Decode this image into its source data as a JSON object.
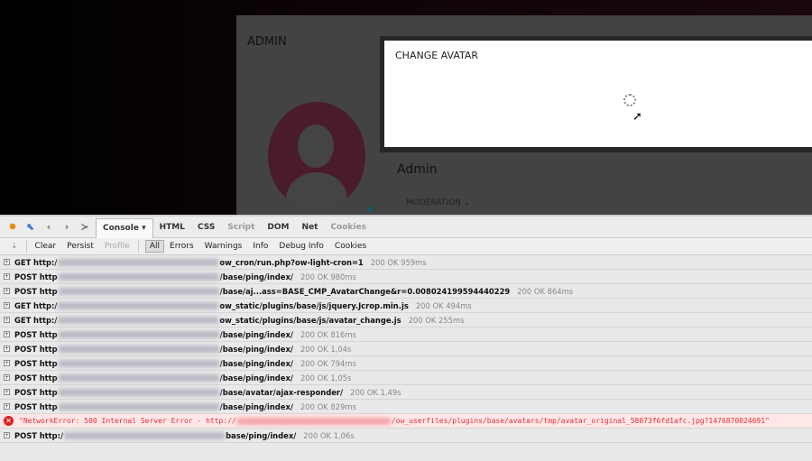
{
  "page": {
    "header": "ADMIN",
    "profile_name": "Admin",
    "moderation_label": "MODERATION",
    "moderation_icon": "chevron-down-icon"
  },
  "modal": {
    "title": "CHANGE AVATAR"
  },
  "devtools": {
    "tabs": [
      "Console",
      "HTML",
      "CSS",
      "Script",
      "DOM",
      "Net",
      "Cookies"
    ],
    "console_toolbar": [
      "Clear",
      "Persist",
      "Profile",
      "All",
      "Errors",
      "Warnings",
      "Info",
      "Debug Info",
      "Cookies"
    ],
    "rows": [
      {
        "method": "GET",
        "prefix": "http:/",
        "path": "ow_cron/run.php?ow-light-cron=1",
        "status": "200 OK 959ms"
      },
      {
        "method": "POST",
        "prefix": "http",
        "path": "/base/ping/index/",
        "status": "200 OK 980ms"
      },
      {
        "method": "POST",
        "prefix": "http",
        "path": "/base/aj...ass=BASE_CMP_AvatarChange&r=0.008024199594440229",
        "status": "200 OK 864ms"
      },
      {
        "method": "GET",
        "prefix": "http:/",
        "path": "ow_static/plugins/base/js/jquery.Jcrop.min.js",
        "status": "200 OK 494ms"
      },
      {
        "method": "GET",
        "prefix": "http:/",
        "path": "ow_static/plugins/base/js/avatar_change.js",
        "status": "200 OK 255ms"
      },
      {
        "method": "POST",
        "prefix": "http",
        "path": "/base/ping/index/",
        "status": "200 OK 816ms"
      },
      {
        "method": "POST",
        "prefix": "http",
        "path": "/base/ping/index/",
        "status": "200 OK 1,04s"
      },
      {
        "method": "POST",
        "prefix": "http",
        "path": "/base/ping/index/",
        "status": "200 OK 794ms"
      },
      {
        "method": "POST",
        "prefix": "http",
        "path": "/base/ping/index/",
        "status": "200 OK 1,05s"
      },
      {
        "method": "POST",
        "prefix": "http",
        "path": "/base/avatar/ajax-responder/",
        "status": "200 OK 1,49s"
      },
      {
        "method": "POST",
        "prefix": "http",
        "path": "/base/ping/index/",
        "status": "200 OK 829ms"
      }
    ],
    "error": {
      "prefix": "\"NetworkError: 500 Internal Server Error - http://",
      "path": "/ow_userfiles/plugins/base/avatars/tmp/avatar_original_58073f6fd1afc.jpg?1476870024691\""
    },
    "last_row": {
      "method": "POST",
      "prefix": "http:/",
      "path": "base/ping/index/",
      "status": "200 OK 1,06s"
    }
  }
}
